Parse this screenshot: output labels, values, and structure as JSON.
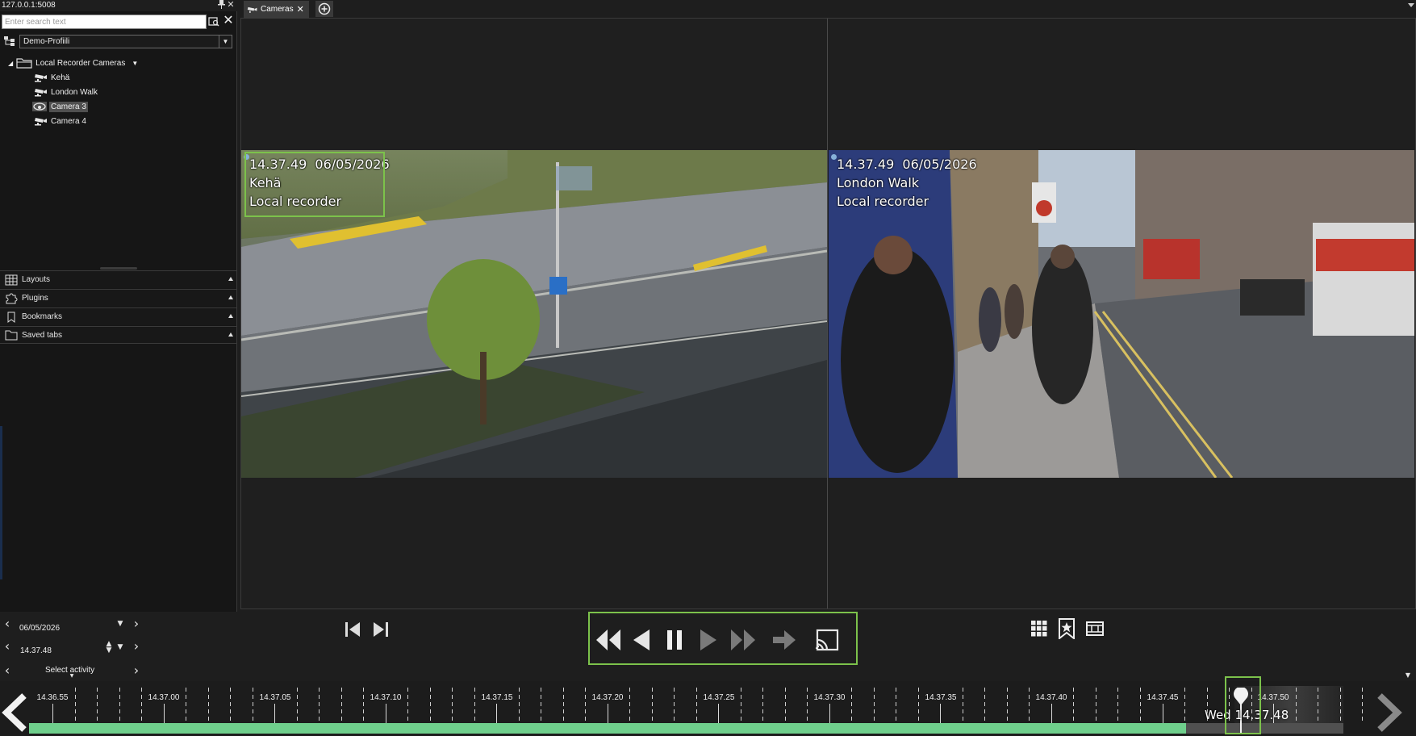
{
  "window": {
    "address": "127.0.0.1:5008"
  },
  "search": {
    "placeholder": "Enter search text"
  },
  "profile": {
    "selected": "Demo-Profiili"
  },
  "tree": {
    "root_label": "Local Recorder Cameras",
    "cameras": [
      {
        "label": "Kehä",
        "icon": "camera-icon",
        "selected": false
      },
      {
        "label": "London Walk",
        "icon": "camera-icon",
        "selected": false
      },
      {
        "label": "Camera 3",
        "icon": "dome-camera-icon",
        "selected": true
      },
      {
        "label": "Camera 4",
        "icon": "camera-icon",
        "selected": false
      }
    ]
  },
  "panels": [
    {
      "label": "Layouts",
      "icon": "grid-icon"
    },
    {
      "label": "Plugins",
      "icon": "puzzle-icon"
    },
    {
      "label": "Bookmarks",
      "icon": "bookmark-icon"
    },
    {
      "label": "Saved tabs",
      "icon": "folder-icon"
    }
  ],
  "tabs": [
    {
      "label": "Cameras",
      "active": true
    }
  ],
  "tiles": [
    {
      "time": "14.37.49",
      "date": "06/05/2026",
      "name": "Kehä",
      "source": "Local recorder"
    },
    {
      "time": "14.37.49",
      "date": "06/05/2026",
      "name": "London Walk",
      "source": "Local recorder"
    }
  ],
  "controls": {
    "date": "06/05/2026",
    "time": "14.37.48",
    "activity": "Select activity"
  },
  "timeline": {
    "labels": [
      "14.36.55",
      "14.37.00",
      "14.37.05",
      "14.37.10",
      "14.37.15",
      "14.37.20",
      "14.37.25",
      "14.37.30",
      "14.37.35",
      "14.37.40",
      "14.37.45",
      "14.37.50"
    ],
    "cursor": "Wed 14.37.48"
  },
  "colors": {
    "accent_green": "#7cc24b",
    "recording_green": "#6fcf8c",
    "background": "#1e1e1e"
  }
}
